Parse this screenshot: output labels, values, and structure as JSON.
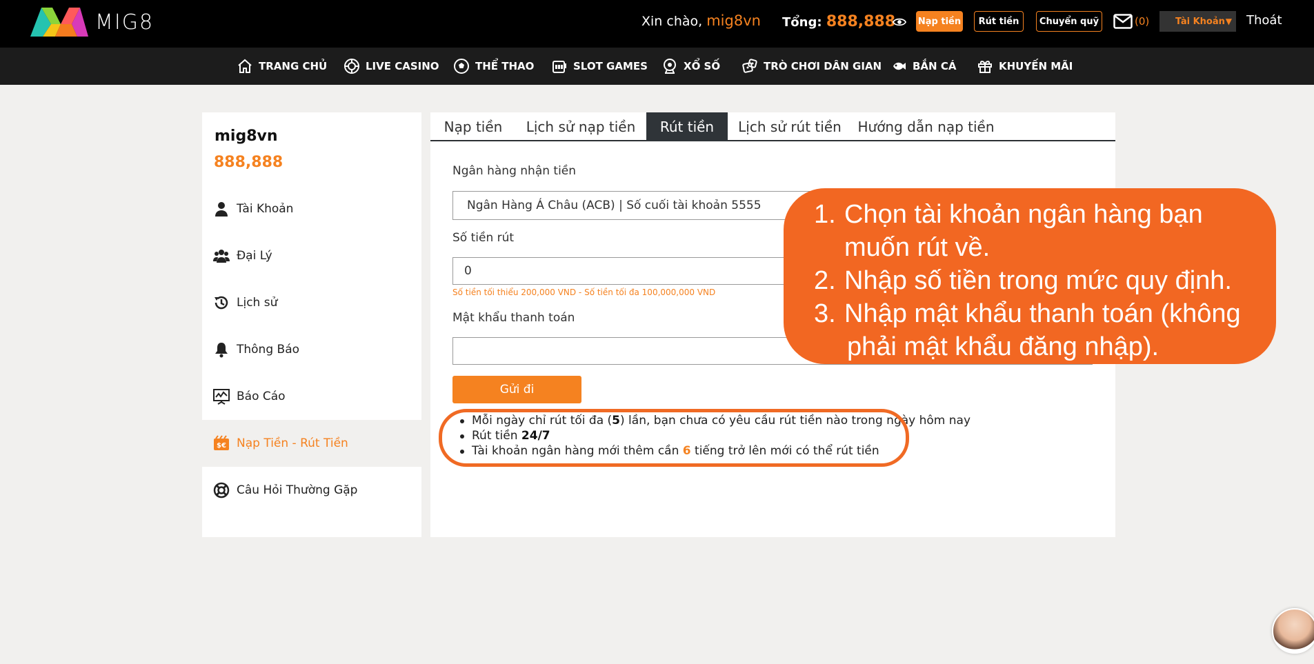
{
  "header": {
    "logo_text": "MIG8",
    "greeting": "Xin chào,",
    "username": "mig8vn",
    "total_label": "Tổng:",
    "total_amount": "888,888",
    "deposit_button": "Nạp tiền",
    "withdraw_button": "Rút tiền",
    "transfer_button": "Chuyển quỹ",
    "mail_count": "(0)",
    "account_select": "Tài Khoản",
    "logout": "Thoát"
  },
  "nav": {
    "items": [
      {
        "label": "TRANG CHỦ",
        "icon": "home-icon"
      },
      {
        "label": "LIVE CASINO",
        "icon": "casino-chip-icon"
      },
      {
        "label": "THỂ THAO",
        "icon": "soccer-ball-icon"
      },
      {
        "label": "SLOT GAMES",
        "icon": "slot-machine-icon"
      },
      {
        "label": "XỔ SỐ",
        "icon": "lottery-icon"
      },
      {
        "label": "TRÒ CHƠI DÂN GIAN",
        "icon": "dice-icon"
      },
      {
        "label": "BẮN CÁ",
        "icon": "fish-icon"
      },
      {
        "label": "KHUYẾN MÃI",
        "icon": "gift-icon"
      }
    ]
  },
  "sidebar": {
    "username": "mig8vn",
    "balance": "888,888",
    "items": [
      {
        "label": "Tài Khoản",
        "icon": "user-icon"
      },
      {
        "label": "Đại Lý",
        "icon": "users-group-icon"
      },
      {
        "label": "Lịch sử",
        "icon": "history-icon"
      },
      {
        "label": "Thông Báo",
        "icon": "bell-icon"
      },
      {
        "label": "Báo Cáo",
        "icon": "report-chart-icon"
      },
      {
        "label": "Nạp Tiền - Rút Tiền",
        "icon": "wallet-icon"
      },
      {
        "label": "Câu Hỏi Thường Gặp",
        "icon": "lifebuoy-icon"
      }
    ]
  },
  "tabs": [
    "Nạp tiền",
    "Lịch sử nạp tiền",
    "Rút tiền",
    "Lịch sử rút tiền",
    "Hướng dẫn nạp tiền"
  ],
  "form": {
    "bank_label": "Ngân hàng nhận tiền",
    "bank_value": "Ngân Hàng Á Châu (ACB) | Số cuối tài khoản 5555",
    "amount_label": "Số tiền rút",
    "amount_value": "0",
    "amount_hint": "Số tiền tối thiểu 200,000 VND - Số tiền tối đa 100,000,000 VND",
    "password_label": "Mật khẩu thanh toán",
    "password_value": "",
    "submit": "Gửi đi"
  },
  "notes": {
    "n1_a": "Mỗi ngày chỉ rút tối đa (",
    "n1_b": "5",
    "n1_c": ") lần, bạn chưa có yêu cầu rút tiền nào trong ngày hôm nay",
    "n2_a": "Rút tiền ",
    "n2_b": "24/7",
    "n3_a": "Tài khoản ngân hàng mới thêm cần ",
    "n3_b": "6",
    "n3_c": " tiếng trở lên mới có thể rút tiền"
  },
  "callout": {
    "l1_num": "1.",
    "l1": "Chọn tài khoản ngân hàng bạn",
    "l1_cont": "muốn rút về.",
    "l2_num": "2.",
    "l2": "Nhập số tiền trong mức quy định.",
    "l3_num": "3.",
    "l3": "Nhập mật khẩu thanh toán (không",
    "l3_cont": "phải mật khẩu đăng nhập)."
  },
  "colors": {
    "accent": "#f58220",
    "callout": "#f26722",
    "header_bg": "#000000",
    "nav_bg": "#1c1c1c",
    "active_tab": "#2f3438"
  }
}
